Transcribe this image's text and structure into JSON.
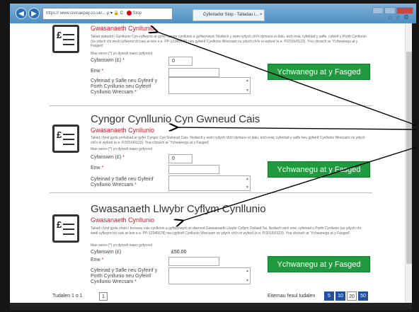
{
  "browser": {
    "address_prefix": "https://",
    "address_url": "www.civicaepay.co.uk/...",
    "address_controls": "ρ ▾ 🔒 C",
    "rec_label": "Stop",
    "tab_title": "Cyfeiriadur Siop - Taliadau i... ×",
    "tab_close": "×"
  },
  "sections": [
    {
      "heading": "",
      "sub": "Gwasanaeth Cynllunio",
      "desc": "Taliad statudol i Gynllunio Cyn-cyflwyno ar gyfer cyngor cynllunio a gyflwynwyd. Nodwch y swm rydych chi'n dymuno ei dalu, eich enw, cyfeiriad y safle, cyfeirif y Porth Cynllunio (os ydych chi wedi cyflwyno'ch cais ar-lein e.e. PP-12345678) neu gyfeirif Cynllunio Wrecsam os ydych chi'n ei wybod (e.e. P/2016/0123). Yna cliciwch ar 'Ychwanegu at y Fasged'.",
      "required_note": "Mae seren (*) yn dynodi maes gofynnol",
      "amount_label": "Cyfanswm (£)",
      "amount_value": "0",
      "name_label": "Enw",
      "address_label": "Cyfeiriad y Safle neu Gyfeirif y Porth Cynllunio neu Gyfeirif Cynllunio Wrecsam",
      "button": "Ychwanegu at y Fasged"
    },
    {
      "heading": "Cyngor Cynllunio Cyn Gwneud Cais",
      "sub": "Gwasanaeth Cynllunio",
      "desc": "Taliad i fynd gyda ymholiad ar gyfer Cyngor Cyn Gwneud Cais. Nodwch y swm rydych chi'n dymuno ei dalu, eich enw, cyfeiriad y safle neu gyfeirif Cynllunio Wrecsam os ydych chi'n ei wybod (e.e. P/2016/0123). Yna cliciwch ar 'Ychwanegu at y Fasged'.",
      "required_note": "Mae seren (*) yn dynodi maes gofynnol",
      "amount_label": "Cyfanswm (£)",
      "amount_value": "0",
      "name_label": "Enw",
      "address_label": "Cyfeiriad y Safle neu Gyfeirif Cynllunio Wrecsam",
      "button": "Ychwanegu at y Fasged"
    },
    {
      "heading": "Gwasanaeth Llwybr Cyflym Cynllunio",
      "sub": "Gwasanaeth Cynllunio",
      "desc": "Taliad i fynd gyda chais i brosesu cais cynllunio a gyflwynwyd un diwrnod Gwasanaeth Llwybr Cyflym Deiliaid Tai. Nodwch eich enw, cyfeiriad y Porth Cynllunio (os ydych chi wedi cyflwyno'ch cais ar-lein e.e. PP-12345678) neu gyfeirif Cynllunio Wrecsam os ydych chi'n ei wybod (e.e. P/2016/0123). Yna cliciwch ar 'Ychwanegu at y Fasged'.",
      "required_note": "Mae seren (*) yn dynodi maes gofynnol",
      "amount_label": "Cyfanswm (£)",
      "amount_value": "£50.00",
      "name_label": "Enw",
      "address_label": "Cyfeiriad y Safle neu Gyfeirif y Porth Cynllunio neu Gyfeirif Cynllunio Wrecsam",
      "button": "Ychwanegu at y Fasged"
    }
  ],
  "footer": {
    "page_label": "Tudalen 1 o 1",
    "page_number": "1",
    "per_page_label": "Eitemau fesul tudalen",
    "per_page_options": [
      "5",
      "10",
      "20",
      "50"
    ]
  },
  "colors": {
    "accent_red": "#c0182c",
    "button_green": "#1f9a3e",
    "pager_blue": "#2450a0"
  }
}
